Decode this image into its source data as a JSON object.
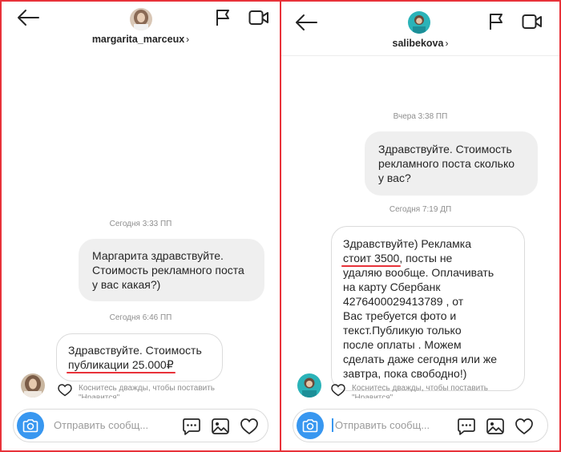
{
  "left": {
    "header": {
      "username": "margarita_marceux",
      "chevron": "›"
    },
    "timestamps": [
      "Сегодня 3:33 ПП",
      "Сегодня 6:46 ПП"
    ],
    "outgoing": {
      "lines": [
        "Маргарита здравствуйте.",
        "Стоимость рекламного поста",
        "у вас какая?)"
      ]
    },
    "incoming": {
      "line1": "Здравствуйте. Стоимость",
      "line2": "публикации 25.000₽"
    },
    "like_hint": {
      "line1": "Коснитесь дважды, чтобы поставить",
      "line2": "\"Нравится\""
    },
    "composer": {
      "placeholder": "Отправить сообщ..."
    }
  },
  "right": {
    "header": {
      "username": "salibekova",
      "chevron": "›"
    },
    "timestamps": [
      "Вчера 3:38 ПП",
      "Сегодня 7:19 ДП"
    ],
    "outgoing": {
      "lines": [
        "Здравствуйте. Стоимость",
        "рекламного поста сколько",
        "у вас?"
      ]
    },
    "incoming": {
      "line1": "Здравствуйте) Рекламка",
      "line2_underlined": "стоит 3500",
      "line2_rest": ", посты не",
      "lines_rest": [
        "удаляю вообще. Оплачивать",
        "на карту Сбербанк",
        "4276400029413789 , от",
        "Вас требуется фото и",
        "текст.Публикую только",
        "после оплаты . Можем",
        "сделать даже сегодня или же",
        "завтра, пока свободно!)"
      ]
    },
    "like_hint": {
      "line1": "Коснитесь дважды, чтобы поставить",
      "line2": "\"Нравится\""
    },
    "composer": {
      "placeholder": "Отправить сообщ..."
    }
  },
  "colors": {
    "accent_red": "#e8323a",
    "camera_blue": "#3897f0",
    "bubble_gray": "#efefef",
    "meta_gray": "#8e8e8e"
  },
  "icons": [
    "back-arrow-icon",
    "flag-icon",
    "video-call-icon",
    "camera-icon",
    "more-icon",
    "gallery-icon",
    "heart-icon"
  ]
}
